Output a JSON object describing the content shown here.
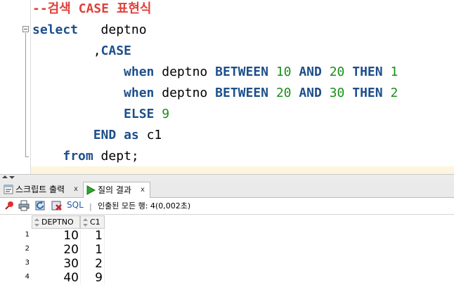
{
  "editor": {
    "lines": [
      {
        "segments": [
          {
            "t": "--검색 CASE 표현식",
            "c": "cmt"
          }
        ]
      },
      {
        "segments": [
          {
            "t": "select",
            "c": "kw"
          },
          {
            "t": "   deptno",
            "c": "plain"
          }
        ]
      },
      {
        "segments": [
          {
            "t": "        ,",
            "c": "plain"
          },
          {
            "t": "CASE",
            "c": "kw"
          }
        ]
      },
      {
        "segments": [
          {
            "t": "            ",
            "c": "plain"
          },
          {
            "t": "when",
            "c": "kw"
          },
          {
            "t": " deptno ",
            "c": "plain"
          },
          {
            "t": "BETWEEN",
            "c": "kw"
          },
          {
            "t": " ",
            "c": "plain"
          },
          {
            "t": "10",
            "c": "num"
          },
          {
            "t": " ",
            "c": "plain"
          },
          {
            "t": "AND",
            "c": "kw"
          },
          {
            "t": " ",
            "c": "plain"
          },
          {
            "t": "20",
            "c": "num"
          },
          {
            "t": " ",
            "c": "plain"
          },
          {
            "t": "THEN",
            "c": "kw"
          },
          {
            "t": " ",
            "c": "plain"
          },
          {
            "t": "1",
            "c": "num"
          }
        ]
      },
      {
        "segments": [
          {
            "t": "            ",
            "c": "plain"
          },
          {
            "t": "when",
            "c": "kw"
          },
          {
            "t": " deptno ",
            "c": "plain"
          },
          {
            "t": "BETWEEN",
            "c": "kw"
          },
          {
            "t": " ",
            "c": "plain"
          },
          {
            "t": "20",
            "c": "num"
          },
          {
            "t": " ",
            "c": "plain"
          },
          {
            "t": "AND",
            "c": "kw"
          },
          {
            "t": " ",
            "c": "plain"
          },
          {
            "t": "30",
            "c": "num"
          },
          {
            "t": " ",
            "c": "plain"
          },
          {
            "t": "THEN",
            "c": "kw"
          },
          {
            "t": " ",
            "c": "plain"
          },
          {
            "t": "2",
            "c": "num"
          }
        ]
      },
      {
        "segments": [
          {
            "t": "            ",
            "c": "plain"
          },
          {
            "t": "ELSE",
            "c": "kw"
          },
          {
            "t": " ",
            "c": "plain"
          },
          {
            "t": "9",
            "c": "num"
          }
        ]
      },
      {
        "segments": [
          {
            "t": "        ",
            "c": "plain"
          },
          {
            "t": "END",
            "c": "kw"
          },
          {
            "t": " ",
            "c": "plain"
          },
          {
            "t": "as",
            "c": "kw"
          },
          {
            "t": " c1",
            "c": "plain"
          }
        ]
      },
      {
        "segments": [
          {
            "t": "    ",
            "c": "plain"
          },
          {
            "t": "from",
            "c": "kw"
          },
          {
            "t": " dept;",
            "c": "plain"
          }
        ]
      }
    ]
  },
  "tabs": {
    "script_output": {
      "label": "스크립트 출력",
      "close": "x"
    },
    "query_result": {
      "label": "질의 결과",
      "close": "x"
    }
  },
  "toolbar": {
    "sql_label": "SQL",
    "separator": "|",
    "fetch_status": "인출된 모든 행: 4(0,002초)"
  },
  "grid": {
    "columns": [
      "DEPTNO",
      "C1"
    ],
    "rows": [
      {
        "num": "1",
        "deptno": "10",
        "c1": "1"
      },
      {
        "num": "2",
        "deptno": "20",
        "c1": "1"
      },
      {
        "num": "3",
        "deptno": "30",
        "c1": "2"
      },
      {
        "num": "4",
        "deptno": "40",
        "c1": "9"
      }
    ]
  },
  "colors": {
    "keyword": "#1d4f8b",
    "number": "#1a8e1a",
    "comment": "#e0403a",
    "current_line": "#fdf5df"
  }
}
